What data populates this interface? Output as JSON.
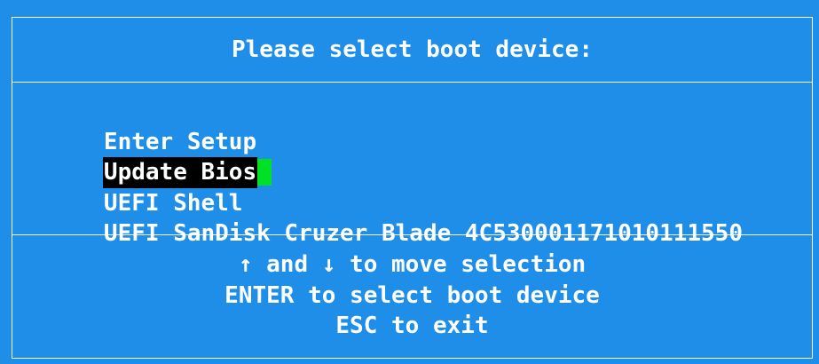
{
  "header": {
    "title": "Please select boot device:"
  },
  "menu": {
    "items": [
      {
        "label": "Enter Setup",
        "selected": false
      },
      {
        "label": "Update Bios",
        "selected": true
      },
      {
        "label": "UEFI Shell",
        "selected": false
      },
      {
        "label": "UEFI SanDisk Cruzer Blade 4C530001171010111550",
        "selected": false
      }
    ]
  },
  "footer": {
    "lines": [
      "↑ and ↓ to move selection",
      "ENTER to select boot device",
      "ESC to exit"
    ]
  },
  "colors": {
    "background": "#1e8ee8",
    "text": "#ffffff",
    "selection_bg": "#000000",
    "cursor": "#00e025"
  }
}
